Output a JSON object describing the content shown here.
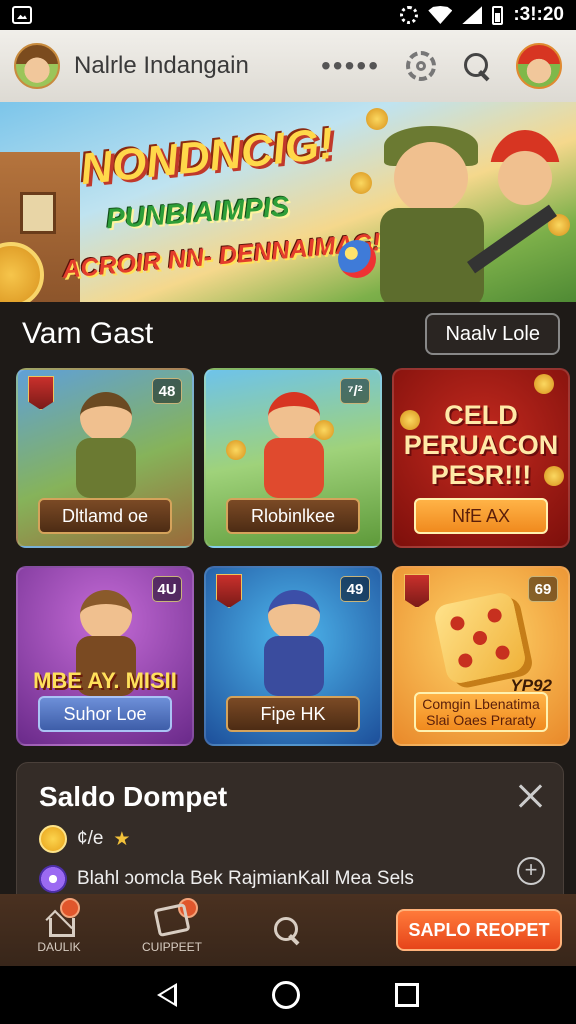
{
  "status_bar": {
    "time": ":3!:20",
    "icons": [
      "gallery-icon",
      "settings-icon",
      "wifi-icon",
      "signal-icon",
      "battery-icon"
    ]
  },
  "app_bar": {
    "title": "Nalrle Indangain",
    "more": "•••••",
    "icons": [
      "avatar",
      "dots-icon",
      "settings-icon",
      "search-icon",
      "profile-avatar"
    ]
  },
  "banner": {
    "line1": "NONDNCIG!",
    "line2": "PUNBIAIMPIS",
    "line3": "ACROIR NN- DENNAIMAG!"
  },
  "section": {
    "title": "Vam Gast",
    "button_label": "Naalv Lole"
  },
  "cards": [
    {
      "badge": "48",
      "label": "Dltlamd oe"
    },
    {
      "badge": "⁷/²",
      "label": "Rlobinlkee"
    },
    {
      "promo": "CELD\nPERUACON\nPESR!!!",
      "label": "NfE AX"
    },
    {
      "badge": "4U",
      "overlay": "MBE AY. MISII",
      "label": "Suhor Loe"
    },
    {
      "badge": "49",
      "label": "Fipe HK"
    },
    {
      "badge": "69",
      "tag": "YP92",
      "label": "Comgin Lbenatima\nSlai Oaes Praraty"
    }
  ],
  "wallet": {
    "title": "Saldo Dompet",
    "balance_text": "¢/e",
    "detail_text": "Blahl ɔomcla Bek RajmianKall Mea Sels",
    "add_label": "+"
  },
  "bottom_nav": {
    "items": [
      {
        "label": "DAULIK",
        "icon": "home-icon"
      },
      {
        "label": "CUIPPEET",
        "icon": "ticket-icon"
      }
    ],
    "cta_label": "SAPLO REOPET"
  },
  "colors": {
    "accent": "#e6451a",
    "app_bar_bg": "#e8e5de",
    "page_bg": "#1e1a17",
    "nav_bg": "#3e2a1c"
  }
}
